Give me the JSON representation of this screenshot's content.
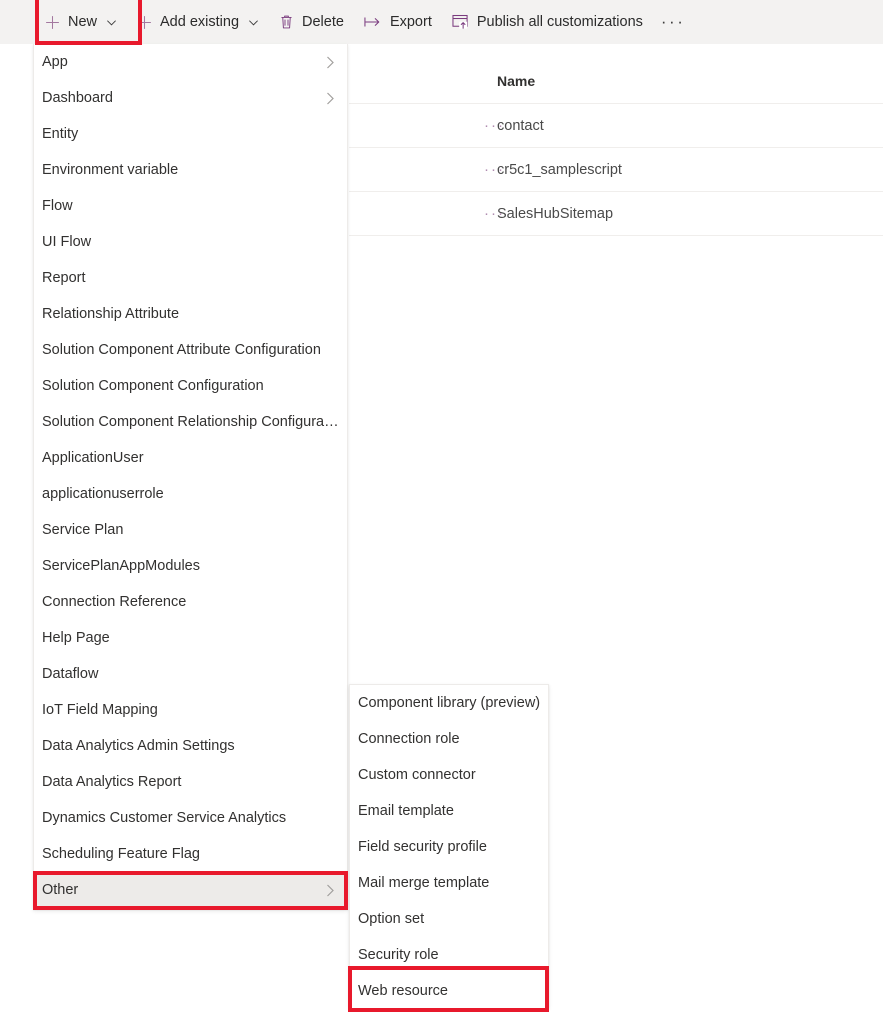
{
  "toolbar": {
    "items": [
      {
        "label": "New",
        "icon": "plus-icon",
        "chevron": true
      },
      {
        "label": "Add existing",
        "icon": "plus-icon",
        "chevron": true
      },
      {
        "label": "Delete",
        "icon": "trash-icon",
        "chevron": false
      },
      {
        "label": "Export",
        "icon": "export-icon",
        "chevron": false
      },
      {
        "label": "Publish all customizations",
        "icon": "publish-icon",
        "chevron": false
      }
    ],
    "overflow_label": "···"
  },
  "new_menu": {
    "items": [
      {
        "label": "App",
        "has_submenu": true,
        "active": false
      },
      {
        "label": "Dashboard",
        "has_submenu": true,
        "active": false
      },
      {
        "label": "Entity",
        "has_submenu": false,
        "active": false
      },
      {
        "label": "Environment variable",
        "has_submenu": false,
        "active": false
      },
      {
        "label": "Flow",
        "has_submenu": false,
        "active": false
      },
      {
        "label": "UI Flow",
        "has_submenu": false,
        "active": false
      },
      {
        "label": "Report",
        "has_submenu": false,
        "active": false
      },
      {
        "label": "Relationship Attribute",
        "has_submenu": false,
        "active": false
      },
      {
        "label": "Solution Component Attribute Configuration",
        "has_submenu": false,
        "active": false
      },
      {
        "label": "Solution Component Configuration",
        "has_submenu": false,
        "active": false
      },
      {
        "label": "Solution Component Relationship Configuration",
        "has_submenu": false,
        "active": false
      },
      {
        "label": "ApplicationUser",
        "has_submenu": false,
        "active": false
      },
      {
        "label": "applicationuserrole",
        "has_submenu": false,
        "active": false
      },
      {
        "label": "Service Plan",
        "has_submenu": false,
        "active": false
      },
      {
        "label": "ServicePlanAppModules",
        "has_submenu": false,
        "active": false
      },
      {
        "label": "Connection Reference",
        "has_submenu": false,
        "active": false
      },
      {
        "label": "Help Page",
        "has_submenu": false,
        "active": false
      },
      {
        "label": "Dataflow",
        "has_submenu": false,
        "active": false
      },
      {
        "label": "IoT Field Mapping",
        "has_submenu": false,
        "active": false
      },
      {
        "label": "Data Analytics Admin Settings",
        "has_submenu": false,
        "active": false
      },
      {
        "label": "Data Analytics Report",
        "has_submenu": false,
        "active": false
      },
      {
        "label": "Dynamics Customer Service Analytics",
        "has_submenu": false,
        "active": false
      },
      {
        "label": "Scheduling Feature Flag",
        "has_submenu": false,
        "active": false
      },
      {
        "label": "Other",
        "has_submenu": true,
        "active": true
      }
    ]
  },
  "other_submenu": {
    "items": [
      {
        "label": "Component library (preview)"
      },
      {
        "label": "Connection role"
      },
      {
        "label": "Custom connector"
      },
      {
        "label": "Email template"
      },
      {
        "label": "Field security profile"
      },
      {
        "label": "Mail merge template"
      },
      {
        "label": "Option set"
      },
      {
        "label": "Security role"
      },
      {
        "label": "Web resource"
      }
    ]
  },
  "grid": {
    "columns": [
      "Name"
    ],
    "rows": [
      {
        "context_menu": "···",
        "name": "contact"
      },
      {
        "context_menu": "···",
        "name": "cr5c1_samplescript"
      },
      {
        "context_menu": "···",
        "name": "SalesHubSitemap"
      }
    ]
  },
  "highlights": {
    "color": "#e8192c",
    "targets": [
      "New",
      "Other",
      "Web resource"
    ]
  }
}
